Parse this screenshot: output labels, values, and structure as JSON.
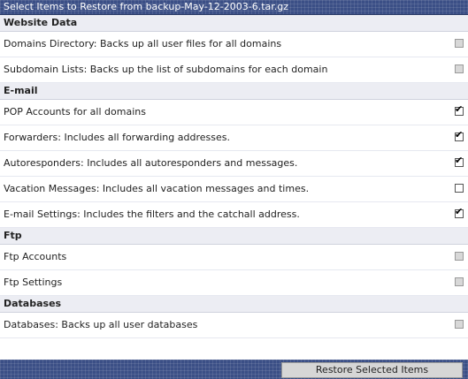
{
  "title": "Select Items to Restore from backup-May-12-2003-6.tar.gz",
  "sections": [
    {
      "header": "Website Data",
      "items": [
        {
          "label": "Domains Directory: Backs up all user files for all domains",
          "checked": false,
          "enabled": false
        },
        {
          "label": "Subdomain Lists: Backs up the list of subdomains for each domain",
          "checked": false,
          "enabled": false
        }
      ]
    },
    {
      "header": "E-mail",
      "items": [
        {
          "label": "POP Accounts for all domains",
          "checked": true,
          "enabled": true
        },
        {
          "label": "Forwarders: Includes all forwarding addresses.",
          "checked": true,
          "enabled": true
        },
        {
          "label": "Autoresponders: Includes all autoresponders and messages.",
          "checked": true,
          "enabled": true
        },
        {
          "label": "Vacation Messages: Includes all vacation messages and times.",
          "checked": false,
          "enabled": true
        },
        {
          "label": "E-mail Settings: Includes the filters and the catchall address.",
          "checked": true,
          "enabled": true
        }
      ]
    },
    {
      "header": "Ftp",
      "items": [
        {
          "label": "Ftp Accounts",
          "checked": false,
          "enabled": false
        },
        {
          "label": "Ftp Settings",
          "checked": false,
          "enabled": false
        }
      ]
    },
    {
      "header": "Databases",
      "items": [
        {
          "label": "Databases: Backs up all user databases",
          "checked": false,
          "enabled": false
        }
      ]
    }
  ],
  "footer": {
    "restore_button_label": "Restore Selected Items"
  }
}
